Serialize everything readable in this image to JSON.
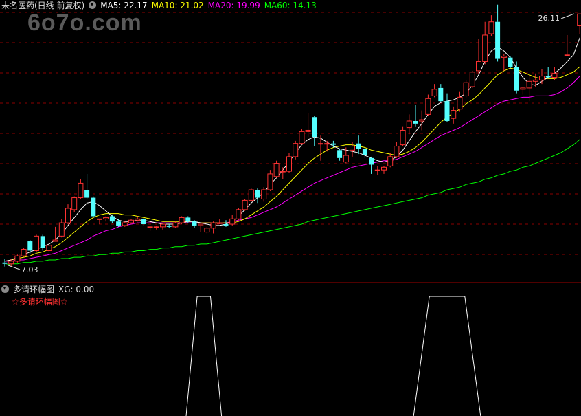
{
  "watermark": "6o7o.com",
  "main_panel": {
    "stock_name": "未名医药(日线 前复权)",
    "ma_labels": [
      {
        "text": "MA5: 22.17",
        "color": "#ffffff"
      },
      {
        "text": "MA10: 21.02",
        "color": "#ffff00"
      },
      {
        "text": "MA20: 19.99",
        "color": "#ff00ff"
      },
      {
        "text": "MA60: 14.13",
        "color": "#00ff00"
      }
    ],
    "high_label": "26.11",
    "low_label": "7.03"
  },
  "indicator_panel": {
    "title": "多请环幅图",
    "xg_label": "XG: 0.00",
    "signal_label": "☆多请环幅图☆"
  },
  "colors": {
    "up": "#ff3232",
    "down": "#54ffff",
    "ma5": "#ffffff",
    "ma10": "#ffff00",
    "ma20": "#ff00ff",
    "ma60": "#00ff00",
    "grid": "#8b0000",
    "xg_line": "#ffffff"
  },
  "chart_data": {
    "type": "candlestick",
    "price_range": [
      7.03,
      26.11
    ],
    "candles": [
      [
        7.3,
        7.2,
        7.6,
        7.0
      ],
      [
        7.2,
        7.4,
        7.6,
        7.0
      ],
      [
        7.4,
        7.8,
        7.9,
        7.3
      ],
      [
        7.8,
        8.3,
        8.4,
        7.7
      ],
      [
        8.9,
        8.2,
        9.0,
        8.0
      ],
      [
        8.2,
        9.3,
        9.4,
        8.1
      ],
      [
        9.3,
        8.4,
        9.4,
        8.2
      ],
      [
        8.2,
        8.6,
        8.7,
        8.1
      ],
      [
        8.9,
        9.0,
        10.0,
        8.9
      ],
      [
        9.3,
        10.3,
        10.6,
        9.2
      ],
      [
        10.3,
        11.4,
        11.7,
        10.2
      ],
      [
        11.3,
        12.2,
        12.3,
        11.1
      ],
      [
        12.2,
        13.3,
        13.6,
        12.1
      ],
      [
        12.8,
        12.2,
        14.0,
        12.1
      ],
      [
        12.2,
        10.8,
        12.3,
        10.7
      ],
      [
        10.6,
        10.6,
        10.6,
        10.2
      ],
      [
        10.6,
        10.7,
        10.8,
        10.4
      ],
      [
        10.8,
        10.4,
        10.9,
        10.3
      ],
      [
        10.4,
        10.1,
        10.6,
        10.0
      ],
      [
        10.1,
        10.3,
        10.4,
        10.0
      ],
      [
        10.3,
        10.5,
        10.6,
        10.2
      ],
      [
        10.5,
        10.6,
        10.8,
        10.4
      ],
      [
        10.6,
        10.2,
        10.7,
        10.1
      ],
      [
        10.0,
        10.0,
        10.1,
        9.7
      ],
      [
        10.0,
        10.0,
        10.1,
        9.8
      ],
      [
        10.0,
        10.2,
        10.3,
        9.8
      ],
      [
        10.1,
        10.0,
        10.2,
        9.9
      ],
      [
        10.0,
        10.3,
        10.4,
        9.9
      ],
      [
        10.3,
        10.7,
        10.8,
        10.2
      ],
      [
        10.7,
        10.4,
        10.8,
        10.3
      ],
      [
        10.4,
        10.1,
        10.5,
        9.9
      ],
      [
        10.1,
        10.2,
        10.2,
        9.6
      ],
      [
        9.6,
        9.9,
        10.0,
        9.5
      ],
      [
        9.9,
        10.3,
        10.4,
        9.5
      ],
      [
        10.3,
        10.3,
        10.6,
        10.2
      ],
      [
        10.2,
        10.1,
        10.5,
        10.0
      ],
      [
        10.2,
        10.6,
        10.9,
        10.1
      ],
      [
        10.6,
        11.3,
        11.4,
        10.5
      ],
      [
        11.3,
        12.0,
        12.1,
        11.2
      ],
      [
        12.0,
        12.8,
        12.9,
        11.9
      ],
      [
        12.8,
        12.2,
        12.9,
        11.8
      ],
      [
        12.1,
        12.8,
        13.0,
        11.9
      ],
      [
        12.8,
        14.0,
        14.3,
        12.7
      ],
      [
        13.8,
        14.8,
        15.0,
        13.7
      ],
      [
        14.2,
        14.2,
        14.5,
        13.6
      ],
      [
        14.2,
        15.3,
        15.6,
        14.1
      ],
      [
        15.3,
        16.3,
        16.5,
        15.1
      ],
      [
        16.3,
        17.2,
        17.4,
        16.2
      ],
      [
        17.2,
        17.3,
        18.6,
        16.8
      ],
      [
        18.3,
        16.8,
        18.4,
        16.1
      ],
      [
        16.3,
        16.3,
        16.9,
        15.0
      ],
      [
        16.3,
        16.3,
        16.5,
        15.7
      ],
      [
        16.3,
        16.2,
        16.5,
        16.0
      ],
      [
        15.8,
        15.2,
        15.9,
        15.0
      ],
      [
        14.9,
        15.4,
        16.0,
        14.8
      ],
      [
        15.8,
        16.1,
        16.4,
        15.3
      ],
      [
        16.3,
        15.9,
        16.9,
        15.5
      ],
      [
        15.9,
        15.4,
        16.0,
        15.2
      ],
      [
        15.2,
        14.7,
        15.3,
        14.0
      ],
      [
        14.3,
        14.3,
        14.6,
        13.9
      ],
      [
        14.3,
        14.5,
        14.6,
        14.0
      ],
      [
        14.6,
        15.3,
        15.6,
        14.5
      ],
      [
        15.3,
        16.1,
        16.4,
        15.2
      ],
      [
        16.2,
        17.3,
        17.6,
        16.1
      ],
      [
        17.5,
        18.0,
        18.5,
        17.0
      ],
      [
        18.0,
        17.8,
        19.2,
        17.6
      ],
      [
        18.0,
        18.1,
        18.8,
        17.3
      ],
      [
        18.5,
        19.7,
        20.0,
        18.4
      ],
      [
        19.9,
        20.4,
        20.8,
        19.8
      ],
      [
        20.5,
        19.5,
        20.8,
        19.4
      ],
      [
        19.5,
        18.0,
        20.1,
        17.9
      ],
      [
        18.2,
        18.8,
        19.1,
        17.8
      ],
      [
        18.9,
        19.8,
        20.2,
        18.7
      ],
      [
        19.9,
        20.9,
        21.1,
        19.8
      ],
      [
        20.6,
        21.7,
        21.8,
        20.5
      ],
      [
        21.8,
        22.5,
        24.2,
        21.6
      ],
      [
        22.5,
        24.5,
        25.5,
        22.3
      ],
      [
        24.6,
        25.5,
        26.0,
        24.4
      ],
      [
        25.5,
        22.7,
        26.8,
        22.5
      ],
      [
        22.8,
        22.9,
        23.1,
        21.8
      ],
      [
        22.8,
        22.1,
        22.9,
        21.9
      ],
      [
        22.1,
        20.3,
        22.5,
        20.1
      ],
      [
        20.4,
        20.5,
        20.6,
        20.0
      ],
      [
        20.5,
        21.0,
        21.5,
        19.5
      ],
      [
        21.0,
        21.1,
        21.6,
        20.6
      ],
      [
        21.1,
        21.4,
        21.9,
        20.8
      ],
      [
        21.4,
        21.3,
        22.1,
        21.2
      ],
      [
        21.3,
        21.6,
        22.1,
        21.1
      ],
      [
        null,
        null,
        null,
        null
      ],
      [
        23.0,
        23.0,
        24.5,
        22.9
      ],
      [
        null,
        null,
        null,
        null
      ],
      [
        25.2,
        26.1,
        26.11,
        24.6
      ]
    ],
    "ma5": [
      7.4,
      7.5,
      7.7,
      7.9,
      8.1,
      8.3,
      8.5,
      8.7,
      9.0,
      9.5,
      10.1,
      10.7,
      11.3,
      11.8,
      11.9,
      11.6,
      11.2,
      10.8,
      10.5,
      10.4,
      10.4,
      10.5,
      10.5,
      10.4,
      10.3,
      10.2,
      10.2,
      10.2,
      10.3,
      10.4,
      10.4,
      10.3,
      10.2,
      10.1,
      10.1,
      10.2,
      10.4,
      10.8,
      11.3,
      11.8,
      12.2,
      12.6,
      13.2,
      13.7,
      14.3,
      14.9,
      15.6,
      16.2,
      16.6,
      16.8,
      16.7,
      16.4,
      16.1,
      15.9,
      15.8,
      15.7,
      15.6,
      15.4,
      15.2,
      15.0,
      14.9,
      15.0,
      15.3,
      15.8,
      16.5,
      17.2,
      17.8,
      18.5,
      19.1,
      19.4,
      19.5,
      19.6,
      19.8,
      20.1,
      20.7,
      21.5,
      22.5,
      23.3,
      23.6,
      23.3,
      22.8,
      22.0,
      21.3,
      20.8,
      20.7,
      21.0,
      21.3,
      21.6,
      22.0,
      22.5,
      23.0,
      24.3
    ],
    "ma10": [
      7.4,
      7.5,
      7.6,
      7.7,
      7.8,
      8.0,
      8.1,
      8.3,
      8.5,
      8.8,
      9.2,
      9.6,
      10.0,
      10.4,
      10.7,
      10.9,
      11.0,
      11.0,
      11.0,
      10.9,
      10.9,
      10.8,
      10.7,
      10.6,
      10.5,
      10.4,
      10.4,
      10.4,
      10.4,
      10.4,
      10.4,
      10.3,
      10.3,
      10.3,
      10.3,
      10.3,
      10.3,
      10.4,
      10.6,
      10.9,
      11.2,
      11.5,
      11.9,
      12.3,
      12.8,
      13.3,
      13.8,
      14.3,
      14.8,
      15.2,
      15.5,
      15.8,
      16.0,
      16.1,
      16.2,
      16.2,
      16.1,
      16.0,
      15.8,
      15.7,
      15.6,
      15.5,
      15.4,
      15.5,
      15.7,
      16.0,
      16.4,
      16.9,
      17.4,
      17.9,
      18.3,
      18.6,
      18.9,
      19.3,
      19.6,
      20.0,
      20.5,
      21.0,
      21.5,
      21.8,
      22.0,
      21.9,
      21.7,
      21.5,
      21.3,
      21.2,
      21.2,
      21.2,
      21.3,
      21.5,
      21.7,
      22.1
    ],
    "ma20": [
      7.4,
      7.4,
      7.5,
      7.5,
      7.6,
      7.7,
      7.8,
      7.9,
      8.0,
      8.2,
      8.4,
      8.6,
      8.8,
      9.0,
      9.3,
      9.5,
      9.7,
      9.8,
      10.0,
      10.1,
      10.2,
      10.3,
      10.3,
      10.3,
      10.3,
      10.3,
      10.3,
      10.3,
      10.3,
      10.3,
      10.3,
      10.3,
      10.3,
      10.3,
      10.3,
      10.3,
      10.4,
      10.5,
      10.6,
      10.7,
      10.9,
      11.1,
      11.3,
      11.5,
      11.8,
      12.1,
      12.4,
      12.7,
      13.0,
      13.3,
      13.5,
      13.7,
      13.9,
      14.1,
      14.3,
      14.5,
      14.6,
      14.7,
      14.8,
      14.9,
      15.0,
      15.0,
      15.1,
      15.3,
      15.5,
      15.7,
      16.0,
      16.3,
      16.6,
      16.9,
      17.1,
      17.3,
      17.5,
      17.8,
      18.1,
      18.4,
      18.7,
      19.0,
      19.3,
      19.5,
      19.6,
      19.7,
      19.8,
      19.8,
      19.9,
      19.9,
      19.9,
      20.0,
      20.2,
      20.5,
      20.9,
      21.4
    ],
    "ma60": [
      7.1,
      7.2,
      7.2,
      7.3,
      7.3,
      7.4,
      7.4,
      7.5,
      7.5,
      7.6,
      7.6,
      7.7,
      7.7,
      7.8,
      7.8,
      7.9,
      7.9,
      8.0,
      8.0,
      8.1,
      8.1,
      8.2,
      8.2,
      8.3,
      8.3,
      8.4,
      8.4,
      8.5,
      8.5,
      8.6,
      8.6,
      8.7,
      8.7,
      8.8,
      8.9,
      9.0,
      9.1,
      9.2,
      9.3,
      9.4,
      9.5,
      9.6,
      9.7,
      9.8,
      9.9,
      10.0,
      10.1,
      10.2,
      10.4,
      10.5,
      10.6,
      10.7,
      10.8,
      10.9,
      11.0,
      11.1,
      11.2,
      11.3,
      11.4,
      11.5,
      11.6,
      11.7,
      11.8,
      11.9,
      12.0,
      12.1,
      12.2,
      12.4,
      12.5,
      12.6,
      12.8,
      12.9,
      13.0,
      13.2,
      13.3,
      13.4,
      13.6,
      13.7,
      13.9,
      14.0,
      14.2,
      14.3,
      14.5,
      14.6,
      14.8,
      15.0,
      15.2,
      15.4,
      15.6,
      15.9,
      16.2,
      16.6
    ],
    "xg_signal_ranges": [
      [
        30,
        33
      ],
      [
        66,
        74
      ]
    ]
  }
}
